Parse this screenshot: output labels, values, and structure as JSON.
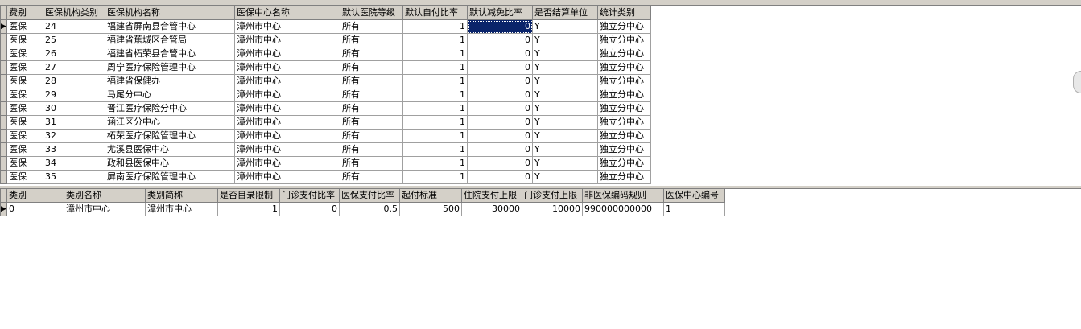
{
  "grid1": {
    "headers": [
      "费别",
      "医保机构类别",
      "医保机构名称",
      "医保中心名称",
      "默认医院等级",
      "默认自付比率",
      "默认减免比率",
      "是否结算单位",
      "统计类别"
    ],
    "rows": [
      [
        "医保",
        "24",
        "福建省屏南县合管中心",
        "漳州市中心",
        "所有",
        "1",
        "0",
        "Y",
        "独立分中心"
      ],
      [
        "医保",
        "25",
        "福建省蕉城区合管局",
        "漳州市中心",
        "所有",
        "1",
        "0",
        "Y",
        "独立分中心"
      ],
      [
        "医保",
        "26",
        "福建省柘荣县合管中心",
        "漳州市中心",
        "所有",
        "1",
        "0",
        "Y",
        "独立分中心"
      ],
      [
        "医保",
        "27",
        "周宁医疗保险管理中心",
        "漳州市中心",
        "所有",
        "1",
        "0",
        "Y",
        "独立分中心"
      ],
      [
        "医保",
        "28",
        "福建省保健办",
        "漳州市中心",
        "所有",
        "1",
        "0",
        "Y",
        "独立分中心"
      ],
      [
        "医保",
        "29",
        "马尾分中心",
        "漳州市中心",
        "所有",
        "1",
        "0",
        "Y",
        "独立分中心"
      ],
      [
        "医保",
        "30",
        "晋江医疗保险分中心",
        "漳州市中心",
        "所有",
        "1",
        "0",
        "Y",
        "独立分中心"
      ],
      [
        "医保",
        "31",
        "涵江区分中心",
        "漳州市中心",
        "所有",
        "1",
        "0",
        "Y",
        "独立分中心"
      ],
      [
        "医保",
        "32",
        "柘荣医疗保险管理中心",
        "漳州市中心",
        "所有",
        "1",
        "0",
        "Y",
        "独立分中心"
      ],
      [
        "医保",
        "33",
        "尤溪县医保中心",
        "漳州市中心",
        "所有",
        "1",
        "0",
        "Y",
        "独立分中心"
      ],
      [
        "医保",
        "34",
        "政和县医保中心",
        "漳州市中心",
        "所有",
        "1",
        "0",
        "Y",
        "独立分中心"
      ],
      [
        "医保",
        "35",
        "屏南医疗保险管理中心",
        "漳州市中心",
        "所有",
        "1",
        "0",
        "Y",
        "独立分中心"
      ]
    ]
  },
  "grid2": {
    "headers": [
      "类别",
      "类别名称",
      "类别简称",
      "是否目录限制",
      "门诊支付比率",
      "医保支付比率",
      "起付标准",
      "住院支付上限",
      "门诊支付上限",
      "非医保编码规则",
      "医保中心编号"
    ],
    "rows": [
      [
        "0",
        "漳州市中心",
        "漳州市中心",
        "1",
        "0",
        "0.5",
        "500",
        "30000",
        "10000",
        "990000000000",
        "1"
      ]
    ]
  }
}
